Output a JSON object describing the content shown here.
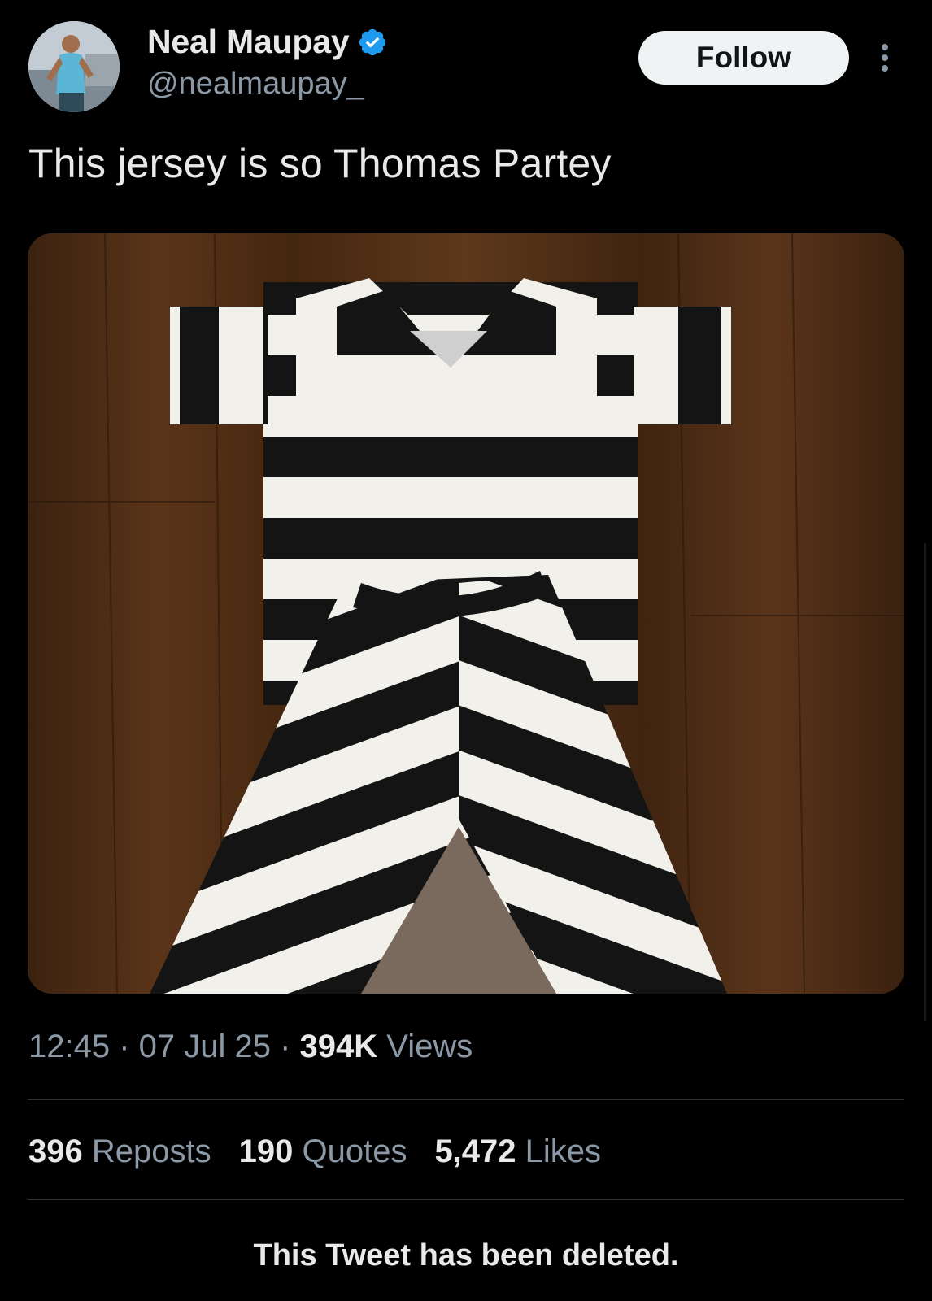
{
  "author": {
    "display_name": "Neal Maupay",
    "handle": "@nealmaupay_",
    "verified_icon": "verified-badge-icon",
    "verified_color": "#1d9bf0"
  },
  "actions": {
    "follow_label": "Follow",
    "more_icon": "more-vertical-icon"
  },
  "tweet": {
    "text": "This jersey is so Thomas Partey",
    "media_icon": "striped-prison-uniform-photo"
  },
  "meta": {
    "time": "12:45",
    "sep1": " · ",
    "date": "07 Jul 25",
    "sep2": " · ",
    "views_count": "394K",
    "views_label": " Views"
  },
  "stats": {
    "reposts_count": "396",
    "reposts_label": " Reposts",
    "quotes_count": "190",
    "quotes_label": " Quotes",
    "likes_count": "5,472",
    "likes_label": " Likes"
  },
  "notice": {
    "deleted_text": "This Tweet has been deleted."
  },
  "colors": {
    "background": "#000000",
    "text_primary": "#e7e9ea",
    "text_secondary": "#8b98a5",
    "button_bg": "#eff3f4",
    "divider": "#2f3336"
  }
}
